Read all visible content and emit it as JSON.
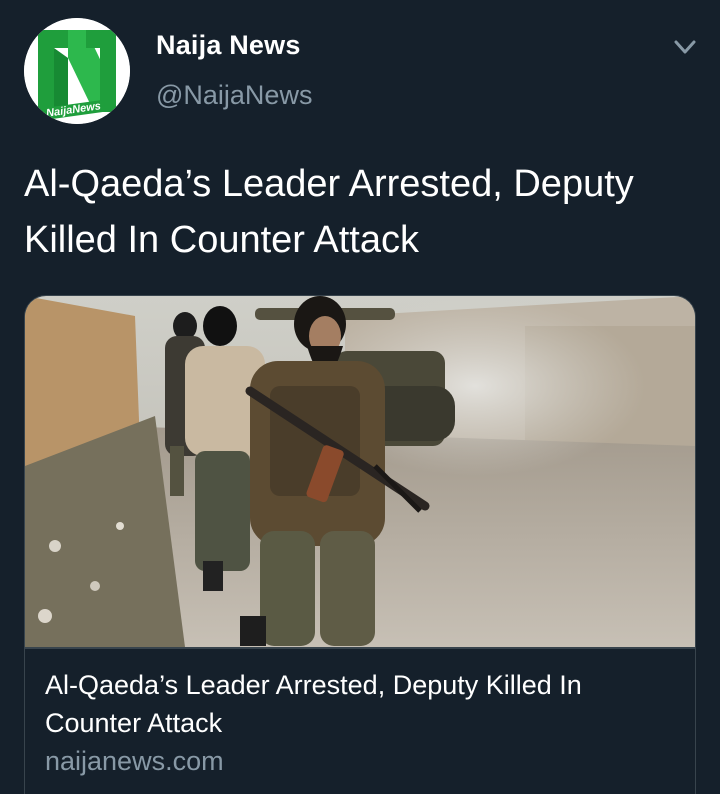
{
  "author": {
    "display_name": "Naija News",
    "handle": "@NaijaNews",
    "avatar_logo_text": "NaijaNews",
    "avatar_icon": "naijanews-logo-icon"
  },
  "menu": {
    "icon": "chevron-down-icon"
  },
  "tweet": {
    "text": "Al-Qaeda’s Leader Arrested, Deputy Killed In Counter Attack"
  },
  "card": {
    "title": "Al-Qaeda’s Leader Arrested, Deputy Killed In Counter Attack",
    "domain": "naijanews.com"
  },
  "colors": {
    "background": "#15202b",
    "secondary_text": "#8899a6",
    "border": "#38444d",
    "logo_green": "#1f9e3c"
  }
}
